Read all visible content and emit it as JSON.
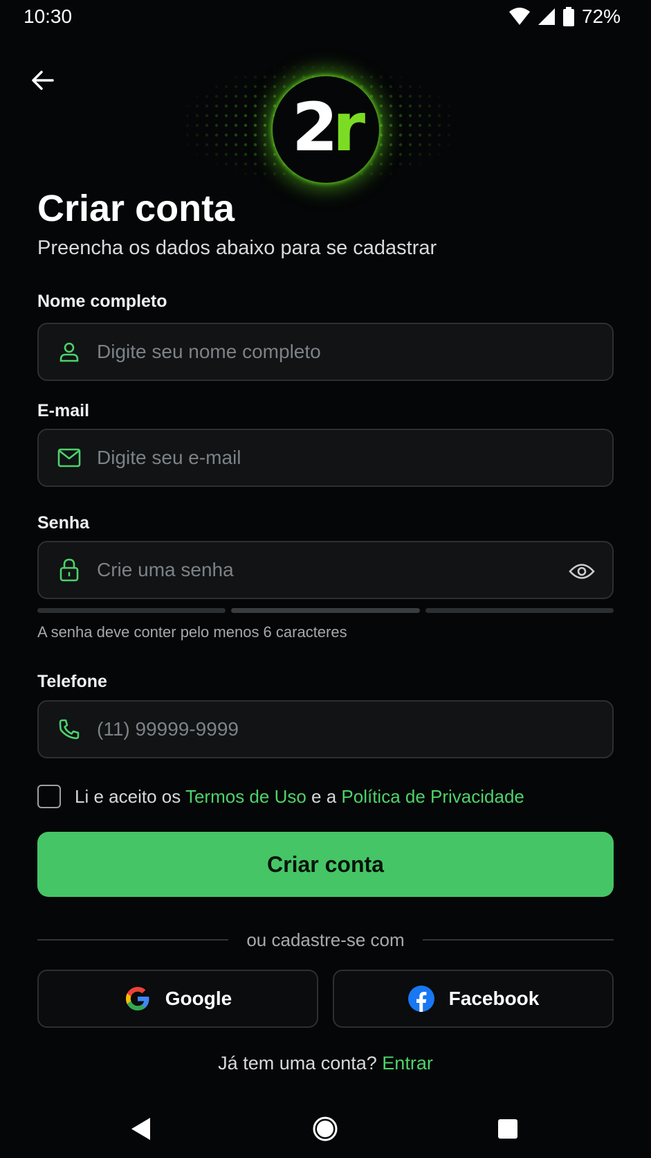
{
  "status_bar": {
    "time": "10:30",
    "battery": "72%",
    "icons": [
      "wifi-icon",
      "cell-signal-icon",
      "battery-icon"
    ]
  },
  "header": {
    "back_icon": "arrow-left-icon",
    "logo_main": "2",
    "logo_accent": "r"
  },
  "page": {
    "title": "Criar conta",
    "subtitle": "Preencha os dados abaixo para se cadastrar"
  },
  "form": {
    "name": {
      "label": "Nome completo",
      "placeholder": "Digite seu nome completo",
      "value": "",
      "icon": "user-icon"
    },
    "email": {
      "label": "E-mail",
      "placeholder": "Digite seu e-mail",
      "value": "",
      "icon": "mail-icon"
    },
    "password": {
      "label": "Senha",
      "placeholder": "Crie uma senha",
      "value": "",
      "icon": "lock-icon",
      "toggle_icon": "eye-icon",
      "hint": "A senha deve conter pelo menos 6 caracteres",
      "strength_segments": 3
    },
    "phone": {
      "label": "Telefone",
      "placeholder": "(11) 99999-9999",
      "value": "",
      "icon": "phone-icon"
    }
  },
  "terms": {
    "checked": false,
    "prefix": "Li e aceito os ",
    "terms_link": "Termos de Uso",
    "middle": " e a ",
    "privacy_link": "Política de Privacidade"
  },
  "submit_label": "Criar conta",
  "divider_text": "ou cadastre-se com",
  "social": {
    "google": {
      "label": "Google",
      "icon": "google-icon"
    },
    "facebook": {
      "label": "Facebook",
      "icon": "facebook-icon"
    }
  },
  "signin": {
    "prompt": "Já tem uma conta? ",
    "link": "Entrar"
  },
  "colors": {
    "background": "#050607",
    "accent": "#46c566",
    "link": "#4cd36b",
    "logo_accent": "#7cdc24",
    "field_bg": "#111315",
    "field_border": "#2c3033"
  },
  "nav": {
    "back": "nav-back-icon",
    "home": "nav-home-icon",
    "recents": "nav-recents-icon"
  }
}
